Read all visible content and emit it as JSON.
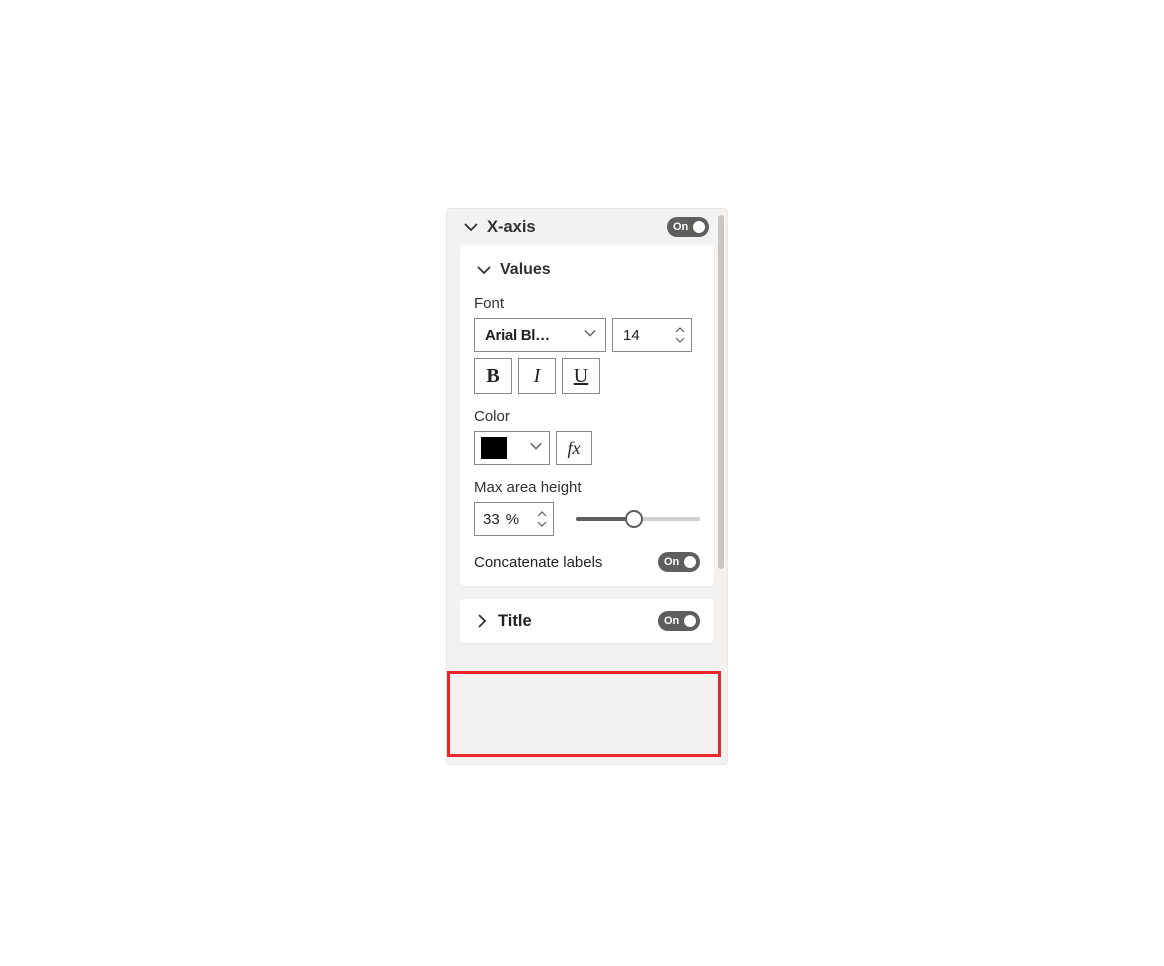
{
  "xAxis": {
    "label": "X-axis",
    "toggle": "On"
  },
  "values": {
    "label": "Values",
    "fontLabel": "Font",
    "fontFamily": "Arial Bl…",
    "fontSize": "14",
    "colorLabel": "Color",
    "colorValue": "#000000",
    "fx": "fx",
    "maxAreaLabel": "Max area height",
    "maxAreaValue": "33",
    "maxAreaUnit": "%",
    "concatLabel": "Concatenate labels",
    "concatToggle": "On"
  },
  "title": {
    "label": "Title",
    "toggle": "On"
  }
}
